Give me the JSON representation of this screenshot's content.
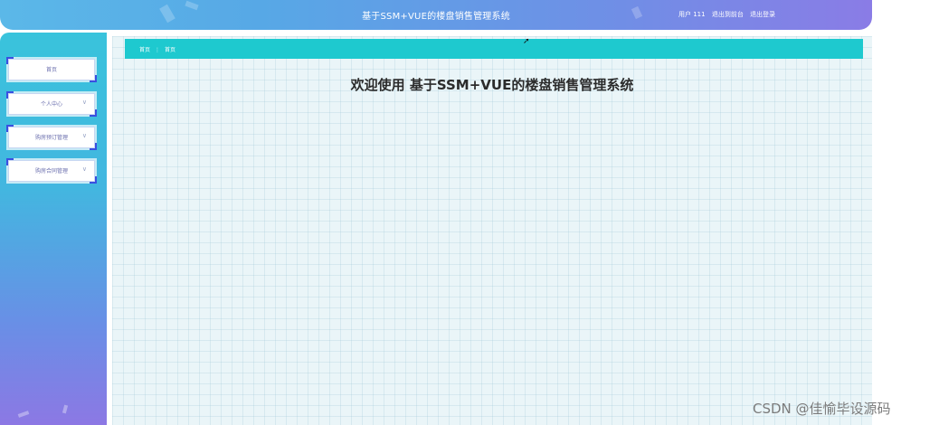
{
  "header": {
    "title": "基于SSM+VUE的楼盘销售管理系统",
    "user_label": "用户 111",
    "back_to_front": "退出到前台",
    "logout": "退出登录"
  },
  "sidebar": {
    "items": [
      {
        "label": "首页",
        "has_chevron": false
      },
      {
        "label": "个人中心",
        "has_chevron": true
      },
      {
        "label": "购房预订管理",
        "has_chevron": true
      },
      {
        "label": "购房合同管理",
        "has_chevron": true
      }
    ]
  },
  "breadcrumb": {
    "home": "首页",
    "separator": "⋮",
    "current": "首页"
  },
  "main": {
    "welcome": "欢迎使用 基于SSM+VUE的楼盘销售管理系统"
  },
  "watermark": "CSDN @佳愉毕设源码",
  "colors": {
    "breadcrumb_bar": "#1ec9cf",
    "sidebar_top": "#39c3dc",
    "sidebar_bottom": "#8c78e4",
    "accent_corner": "#3a4fe0"
  }
}
